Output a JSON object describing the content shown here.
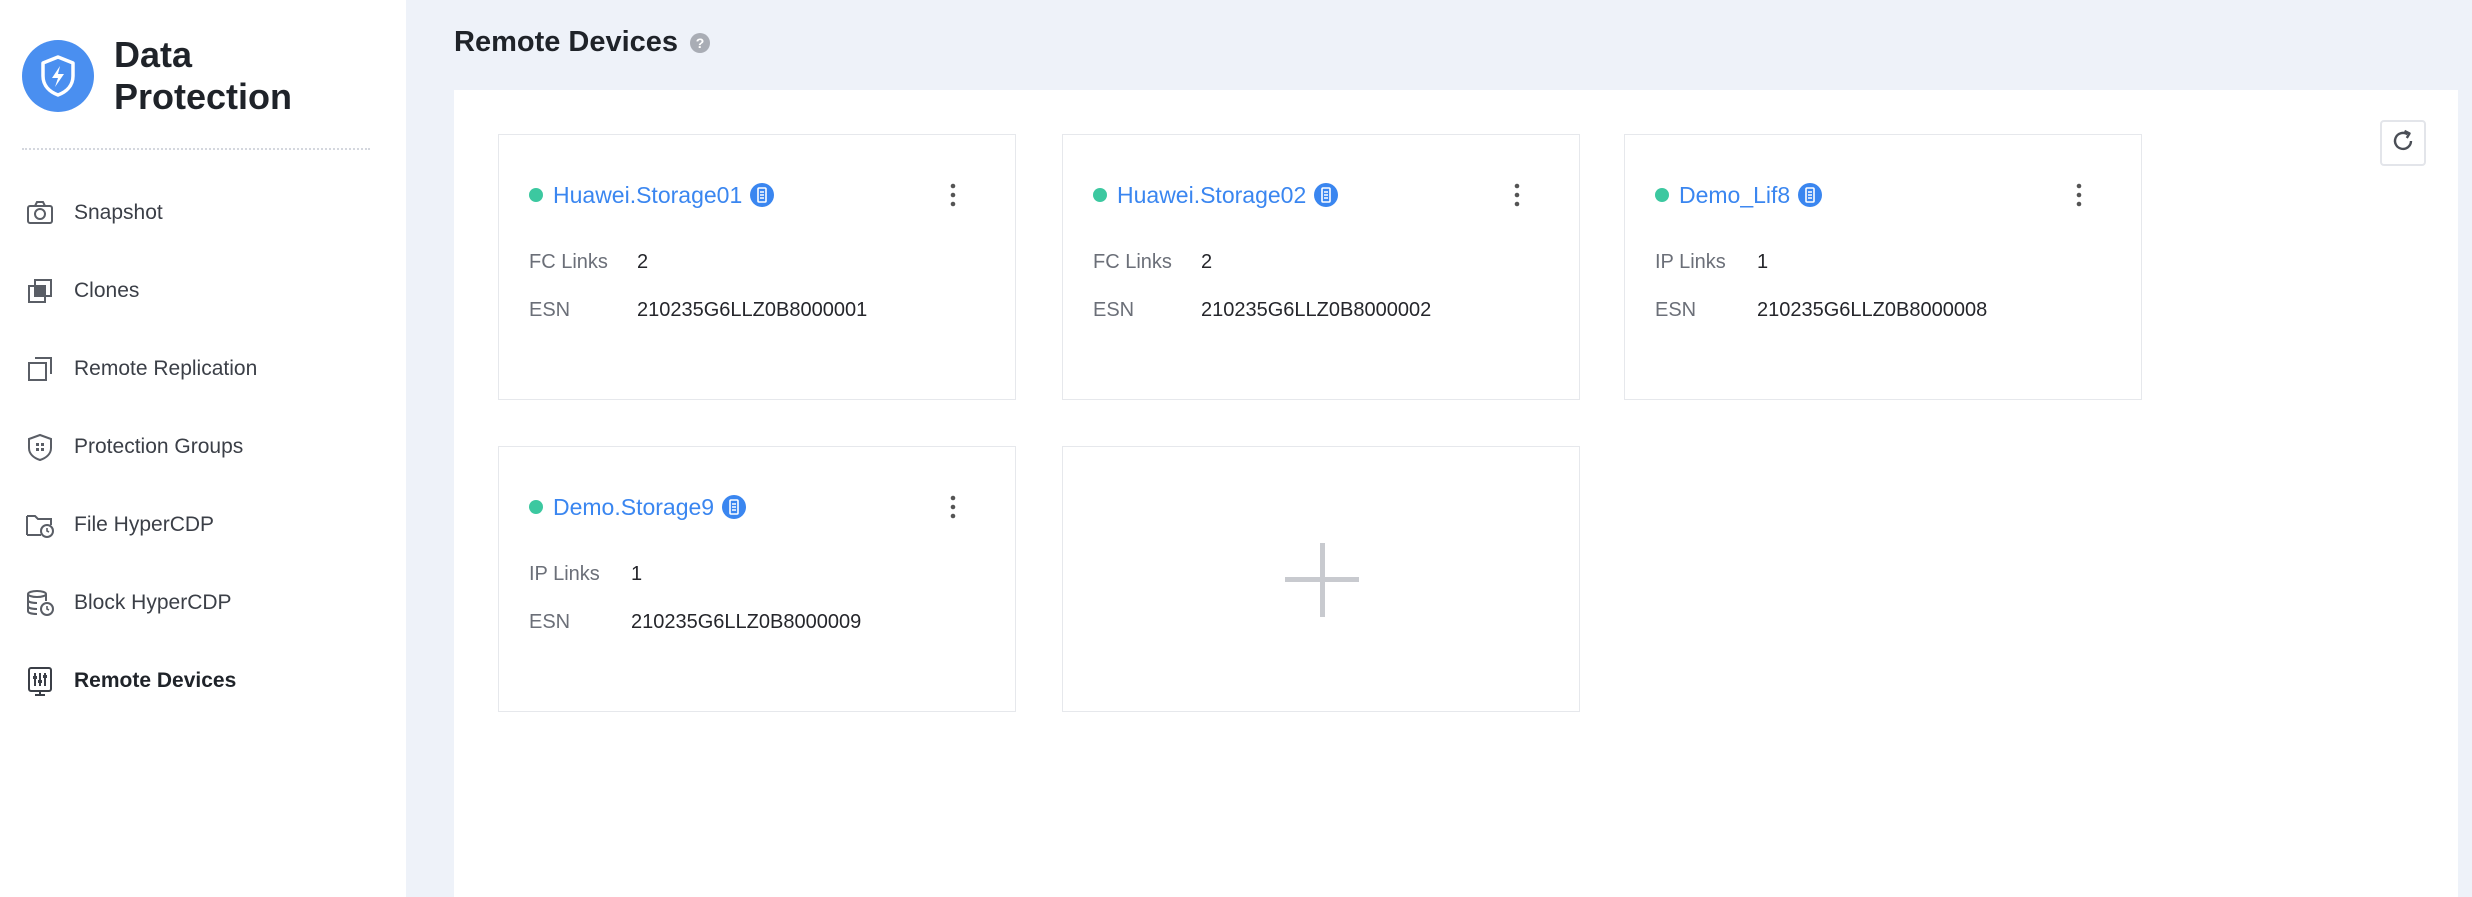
{
  "app": {
    "title_line1": "Data",
    "title_line2": "Protection",
    "logo_icon": "shield-bolt-icon"
  },
  "sidebar": {
    "items": [
      {
        "label": "Snapshot",
        "icon": "camera-icon",
        "active": false
      },
      {
        "label": "Clones",
        "icon": "clones-icon",
        "active": false
      },
      {
        "label": "Remote Replication",
        "icon": "replication-icon",
        "active": false
      },
      {
        "label": "Protection Groups",
        "icon": "shield-group-icon",
        "active": false
      },
      {
        "label": "File HyperCDP",
        "icon": "folder-clock-icon",
        "active": false
      },
      {
        "label": "Block HyperCDP",
        "icon": "database-clock-icon",
        "active": false
      },
      {
        "label": "Remote Devices",
        "icon": "remote-device-icon",
        "active": true
      }
    ]
  },
  "page": {
    "title": "Remote Devices",
    "help_icon": "help-icon",
    "refresh_icon": "refresh-icon"
  },
  "devices": [
    {
      "name": "Huawei.Storage01",
      "status": "online",
      "link_label": "FC Links",
      "links": "2",
      "esn_label": "ESN",
      "esn": "210235G6LLZ0B8000001"
    },
    {
      "name": "Huawei.Storage02",
      "status": "online",
      "link_label": "FC Links",
      "links": "2",
      "esn_label": "ESN",
      "esn": "210235G6LLZ0B8000002"
    },
    {
      "name": "Demo_Lif8",
      "status": "online",
      "link_label": "IP Links",
      "links": "1",
      "esn_label": "ESN",
      "esn": "210235G6LLZ0B8000008"
    },
    {
      "name": "Demo.Storage9",
      "status": "online",
      "link_label": "IP Links",
      "links": "1",
      "esn_label": "ESN",
      "esn": "210235G6LLZ0B8000009"
    }
  ],
  "colors": {
    "accent": "#3a86f0",
    "status_online": "#3cc8a0",
    "background": "#eef2f9"
  }
}
